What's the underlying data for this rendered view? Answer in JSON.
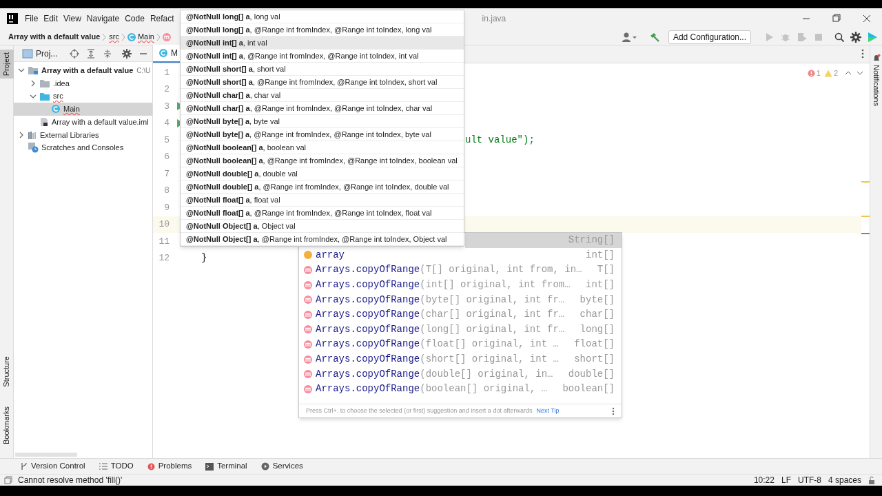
{
  "title_bar": {
    "menu": [
      "File",
      "Edit",
      "View",
      "Navigate",
      "Code",
      "Refact"
    ],
    "title": "in.java"
  },
  "nav_bar": {
    "breadcrumbs": [
      {
        "kind": "project",
        "label": "Array with a default value"
      },
      {
        "kind": "folder",
        "label": "src"
      },
      {
        "kind": "class",
        "label": "Main"
      },
      {
        "kind": "method"
      }
    ],
    "run_config": "Add Configuration..."
  },
  "left_tabs": [
    {
      "label": "Project",
      "selected": true
    },
    {
      "label": "Structure",
      "selected": false
    },
    {
      "label": "Bookmarks",
      "selected": false
    }
  ],
  "project_panel": {
    "title": "Proj...",
    "tree": [
      {
        "kind": "module",
        "label": "Array with a default value",
        "path": "C:\\U",
        "expanded": true,
        "selected": false,
        "children": [
          {
            "kind": "folder",
            "label": ".idea",
            "expanded": false,
            "selected": false
          },
          {
            "kind": "source",
            "label": "src",
            "expanded": true,
            "selected": false,
            "children": [
              {
                "kind": "class",
                "label": "Main",
                "selected": true
              }
            ]
          },
          {
            "kind": "iml",
            "label": "Array with a default value.iml",
            "selected": false
          }
        ]
      },
      {
        "kind": "libraries",
        "label": "External Libraries",
        "expanded": false,
        "selected": false
      },
      {
        "kind": "scratches",
        "label": "Scratches and Consoles",
        "selected": false
      }
    ]
  },
  "editor": {
    "tab": "M",
    "errors": "1",
    "warnings": "2",
    "lines": [
      {
        "number": "1",
        "run": false,
        "current": false
      },
      {
        "number": "2",
        "run": false,
        "current": false
      },
      {
        "number": "3",
        "run": true,
        "current": false
      },
      {
        "number": "4",
        "run": true,
        "current": false
      },
      {
        "number": "5",
        "run": false,
        "current": false,
        "code": "ult value\");"
      },
      {
        "number": "6",
        "run": false,
        "current": false
      },
      {
        "number": "7",
        "run": false,
        "current": false
      },
      {
        "number": "8",
        "run": false,
        "current": false
      },
      {
        "number": "9",
        "run": false,
        "current": false
      },
      {
        "number": "10",
        "run": false,
        "current": true
      },
      {
        "number": "11",
        "run": false,
        "current": false
      },
      {
        "number": "12",
        "run": false,
        "current": false,
        "code": "}"
      }
    ],
    "error_stripe": [
      {
        "kind": "warning"
      },
      {
        "kind": "warning"
      },
      {
        "kind": "error"
      }
    ]
  },
  "param_info": [
    {
      "text": "**@NotNull long[] a**, long val",
      "selected": false
    },
    {
      "text": "**@NotNull long[] a**, @Range int fromIndex, @Range int toIndex, long val",
      "selected": false
    },
    {
      "text": "**@NotNull int[] a**, int val",
      "selected": true
    },
    {
      "text": "**@NotNull int[] a**, @Range int fromIndex, @Range int toIndex, int val",
      "selected": false
    },
    {
      "text": "**@NotNull short[] a**, short val",
      "selected": false
    },
    {
      "text": "**@NotNull short[] a**, @Range int fromIndex, @Range int toIndex, short val",
      "selected": false
    },
    {
      "text": "**@NotNull char[] a**, char val",
      "selected": false
    },
    {
      "text": "**@NotNull char[] a**, @Range int fromIndex, @Range int toIndex, char val",
      "selected": false
    },
    {
      "text": "**@NotNull byte[] a**, byte val",
      "selected": false
    },
    {
      "text": "**@NotNull byte[] a**, @Range int fromIndex, @Range int toIndex, byte val",
      "selected": false
    },
    {
      "text": "**@NotNull boolean[] a**, boolean val",
      "selected": false
    },
    {
      "text": "**@NotNull boolean[] a**, @Range int fromIndex, @Range int toIndex, boolean val",
      "selected": false
    },
    {
      "text": "**@NotNull double[] a**, double val",
      "selected": false
    },
    {
      "text": "**@NotNull double[] a**, @Range int fromIndex, @Range int toIndex, double val",
      "selected": false
    },
    {
      "text": "**@NotNull float[] a**, float val",
      "selected": false
    },
    {
      "text": "**@NotNull float[] a**, @Range int fromIndex, @Range int toIndex, float val",
      "selected": false
    },
    {
      "text": "**@NotNull Object[] a**, Object val",
      "selected": false
    },
    {
      "text": "**@NotNull Object[] a**, @Range int fromIndex, @Range int toIndex, Object val",
      "selected": false
    }
  ],
  "completion": {
    "items": [
      {
        "type": "String[]",
        "selected": true
      },
      {
        "kind": "variable",
        "name": "array",
        "type": "int[]",
        "selected": false
      },
      {
        "kind": "method",
        "name": "Arrays.copyOfRange",
        "params": "(T[] original, int from, in…",
        "type": "T[]",
        "selected": false
      },
      {
        "kind": "method",
        "name": "Arrays.copyOfRange",
        "params": "(int[] original, int from…",
        "type": "int[]",
        "selected": false
      },
      {
        "kind": "method",
        "name": "Arrays.copyOfRange",
        "params": "(byte[] original, int fr…",
        "type": "byte[]",
        "selected": false
      },
      {
        "kind": "method",
        "name": "Arrays.copyOfRange",
        "params": "(char[] original, int fr…",
        "type": "char[]",
        "selected": false
      },
      {
        "kind": "method",
        "name": "Arrays.copyOfRange",
        "params": "(long[] original, int fr…",
        "type": "long[]",
        "selected": false
      },
      {
        "kind": "method",
        "name": "Arrays.copyOfRange",
        "params": "(float[] original, int …",
        "type": "float[]",
        "selected": false
      },
      {
        "kind": "method",
        "name": "Arrays.copyOfRange",
        "params": "(short[] original, int …",
        "type": "short[]",
        "selected": false
      },
      {
        "kind": "method",
        "name": "Arrays.copyOfRange",
        "params": "(double[] original, in…",
        "type": "double[]",
        "selected": false
      },
      {
        "kind": "method",
        "name": "Arrays.copyOfRange",
        "params": "(boolean[] original, …",
        "type": "boolean[]",
        "selected": false
      }
    ],
    "hint": "Press Ctrl+. to choose the selected (or first) suggestion and insert a dot afterwards",
    "hint_link": "Next Tip"
  },
  "right_tabs": [
    {
      "label": "Notifications",
      "selected": false
    }
  ],
  "tool_windows": [
    {
      "kind": "vcs",
      "label": "Version Control"
    },
    {
      "kind": "todo",
      "label": "TODO"
    },
    {
      "kind": "problems",
      "label": "Problems"
    },
    {
      "kind": "terminal",
      "label": "Terminal"
    },
    {
      "kind": "services",
      "label": "Services"
    }
  ],
  "status_bar": {
    "message": "Cannot resolve method 'fill()'",
    "position": "10:22",
    "line_separator": "LF",
    "encoding": "UTF-8",
    "indent": "4 spaces"
  }
}
